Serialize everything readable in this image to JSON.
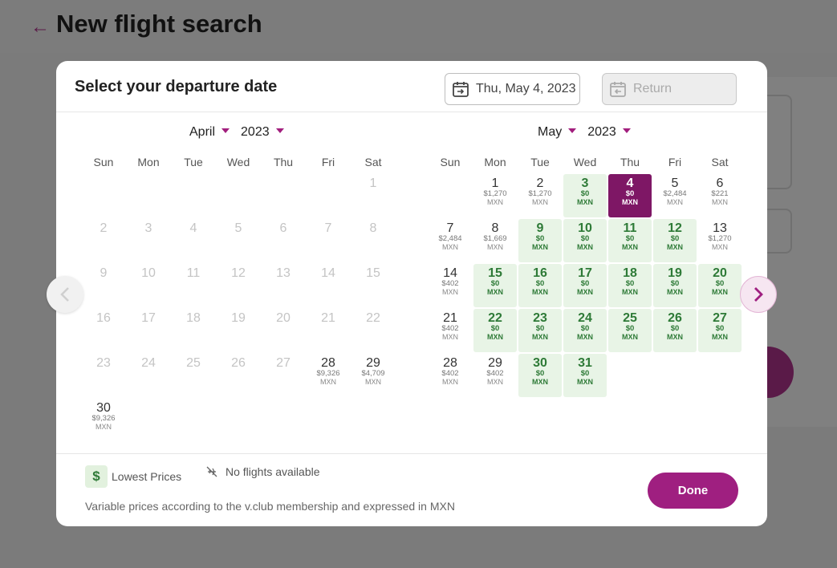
{
  "page": {
    "title": "New flight search",
    "back_icon": "arrow-left-icon"
  },
  "modal": {
    "title": "Select your departure date",
    "departure_value": "Thu, May 4, 2023",
    "return_placeholder": "Return",
    "done_label": "Done"
  },
  "colors": {
    "accent": "#9f1f80",
    "selected": "#7e1765",
    "lowest_price_bg": "#e8f4e6",
    "lowest_price_text": "#2e7a37"
  },
  "days_of_week": [
    "Sun",
    "Mon",
    "Tue",
    "Wed",
    "Thu",
    "Fri",
    "Sat"
  ],
  "calendars": [
    {
      "month": "April",
      "year": "2023",
      "weeks": [
        [
          null,
          null,
          null,
          null,
          null,
          null,
          {
            "d": "1",
            "s": "dis"
          }
        ],
        [
          {
            "d": "2",
            "s": "dis"
          },
          {
            "d": "3",
            "s": "dis"
          },
          {
            "d": "4",
            "s": "dis"
          },
          {
            "d": "5",
            "s": "dis"
          },
          {
            "d": "6",
            "s": "dis"
          },
          {
            "d": "7",
            "s": "dis"
          },
          {
            "d": "8",
            "s": "dis"
          }
        ],
        [
          {
            "d": "9",
            "s": "dis"
          },
          {
            "d": "10",
            "s": "dis"
          },
          {
            "d": "11",
            "s": "dis"
          },
          {
            "d": "12",
            "s": "dis"
          },
          {
            "d": "13",
            "s": "dis"
          },
          {
            "d": "14",
            "s": "dis"
          },
          {
            "d": "15",
            "s": "dis"
          }
        ],
        [
          {
            "d": "16",
            "s": "dis"
          },
          {
            "d": "17",
            "s": "dis"
          },
          {
            "d": "18",
            "s": "dis"
          },
          {
            "d": "19",
            "s": "dis"
          },
          {
            "d": "20",
            "s": "dis"
          },
          {
            "d": "21",
            "s": "dis"
          },
          {
            "d": "22",
            "s": "dis"
          }
        ],
        [
          {
            "d": "23",
            "s": "dis"
          },
          {
            "d": "24",
            "s": "dis"
          },
          {
            "d": "25",
            "s": "dis"
          },
          {
            "d": "26",
            "s": "dis"
          },
          {
            "d": "27",
            "s": "dis"
          },
          {
            "d": "28",
            "p": "$9,326",
            "c": "MXN"
          },
          {
            "d": "29",
            "p": "$4,709",
            "c": "MXN"
          }
        ],
        [
          {
            "d": "30",
            "p": "$9,326",
            "c": "MXN"
          },
          null,
          null,
          null,
          null,
          null,
          null
        ]
      ]
    },
    {
      "month": "May",
      "year": "2023",
      "weeks": [
        [
          null,
          {
            "d": "1",
            "p": "$1,270",
            "c": "MXN"
          },
          {
            "d": "2",
            "p": "$1,270",
            "c": "MXN"
          },
          {
            "d": "3",
            "p": "$0",
            "c": "MXN",
            "s": "low"
          },
          {
            "d": "4",
            "p": "$0",
            "c": "MXN",
            "s": "sel"
          },
          {
            "d": "5",
            "p": "$2,484",
            "c": "MXN"
          },
          {
            "d": "6",
            "p": "$221",
            "c": "MXN"
          }
        ],
        [
          {
            "d": "7",
            "p": "$2,484",
            "c": "MXN"
          },
          {
            "d": "8",
            "p": "$1,669",
            "c": "MXN"
          },
          {
            "d": "9",
            "p": "$0",
            "c": "MXN",
            "s": "low"
          },
          {
            "d": "10",
            "p": "$0",
            "c": "MXN",
            "s": "low"
          },
          {
            "d": "11",
            "p": "$0",
            "c": "MXN",
            "s": "low"
          },
          {
            "d": "12",
            "p": "$0",
            "c": "MXN",
            "s": "low"
          },
          {
            "d": "13",
            "p": "$1,270",
            "c": "MXN"
          }
        ],
        [
          {
            "d": "14",
            "p": "$402",
            "c": "MXN"
          },
          {
            "d": "15",
            "p": "$0",
            "c": "MXN",
            "s": "low"
          },
          {
            "d": "16",
            "p": "$0",
            "c": "MXN",
            "s": "low"
          },
          {
            "d": "17",
            "p": "$0",
            "c": "MXN",
            "s": "low"
          },
          {
            "d": "18",
            "p": "$0",
            "c": "MXN",
            "s": "low"
          },
          {
            "d": "19",
            "p": "$0",
            "c": "MXN",
            "s": "low"
          },
          {
            "d": "20",
            "p": "$0",
            "c": "MXN",
            "s": "low"
          }
        ],
        [
          {
            "d": "21",
            "p": "$402",
            "c": "MXN"
          },
          {
            "d": "22",
            "p": "$0",
            "c": "MXN",
            "s": "low"
          },
          {
            "d": "23",
            "p": "$0",
            "c": "MXN",
            "s": "low"
          },
          {
            "d": "24",
            "p": "$0",
            "c": "MXN",
            "s": "low"
          },
          {
            "d": "25",
            "p": "$0",
            "c": "MXN",
            "s": "low"
          },
          {
            "d": "26",
            "p": "$0",
            "c": "MXN",
            "s": "low"
          },
          {
            "d": "27",
            "p": "$0",
            "c": "MXN",
            "s": "low"
          }
        ],
        [
          {
            "d": "28",
            "p": "$402",
            "c": "MXN"
          },
          {
            "d": "29",
            "p": "$402",
            "c": "MXN"
          },
          {
            "d": "30",
            "p": "$0",
            "c": "MXN",
            "s": "low"
          },
          {
            "d": "31",
            "p": "$0",
            "c": "MXN",
            "s": "low"
          },
          null,
          null,
          null
        ]
      ]
    }
  ],
  "legend": {
    "lowest_symbol": "$",
    "lowest_label": "Lowest Prices",
    "no_flights_label": "No flights available",
    "no_flights_icon": "plane-slash-icon"
  },
  "footnote": "Variable prices according to the v.club membership and expressed in MXN"
}
